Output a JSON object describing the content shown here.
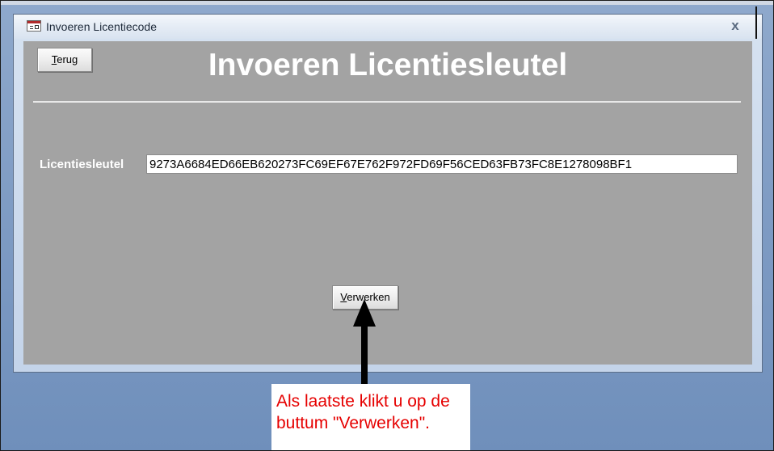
{
  "window": {
    "title": "Invoeren Licentiecode",
    "close_glyph": "x",
    "icon": "form-icon"
  },
  "form": {
    "back_button_label": "Terug",
    "heading": "Invoeren Licentiesleutel",
    "license_label": "Licentiesleutel",
    "license_value": "9273A6684ED66EB620273FC69EF67E762F972FD69F56CED63FB73FC8E1278098BF1",
    "process_button_label": "Verwerken"
  },
  "annotation": {
    "text": "Als laatste klikt u op de buttum \"Verwerken\".",
    "color": "#e60000",
    "arrow_icon": "arrow-up-icon"
  },
  "colors": {
    "form_background": "#a3a3a3",
    "desktop_background": "#7f9cc4"
  }
}
